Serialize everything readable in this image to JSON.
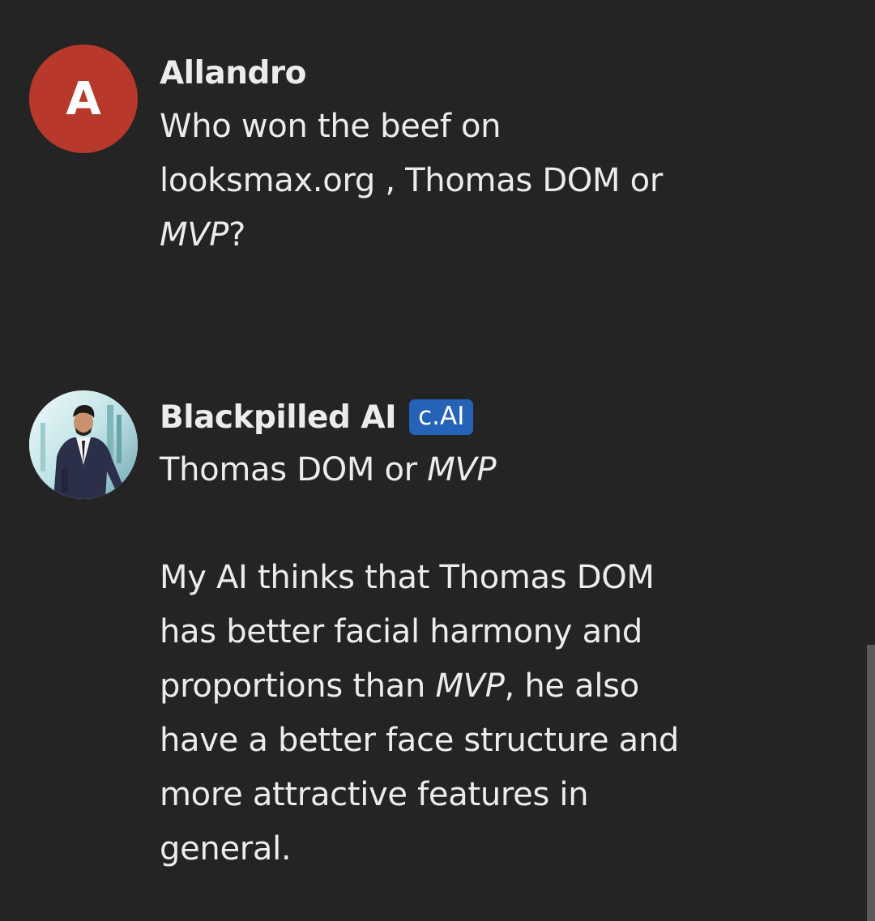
{
  "messages": [
    {
      "sender": "Allandro",
      "avatar_letter": "A",
      "avatar_color": "#b8392c",
      "text": {
        "line1": "Who won the beef on",
        "line2": "looksmax.org , Thomas DOM or",
        "line3_italic": "MVP",
        "line3_rest": "?"
      }
    },
    {
      "sender": "Blackpilled AI",
      "badge": "c.AI",
      "badge_color": "#2463b8",
      "avatar_icon": "man-in-suit-avatar",
      "text": {
        "line1_plain": "Thomas DOM or ",
        "line1_italic": "MVP",
        "p2_line1": "My AI thinks that Thomas DOM",
        "p2_line2": "has better facial harmony and",
        "p2_line3_plain": "proportions than ",
        "p2_line3_italic": "MVP",
        "p2_line3_rest": ", he also",
        "p2_line4": "have a better face structure and",
        "p2_line5": "more attractive features in",
        "p2_line6": "general."
      }
    }
  ],
  "theme": {
    "background": "#242424",
    "text_color": "#ececec"
  }
}
